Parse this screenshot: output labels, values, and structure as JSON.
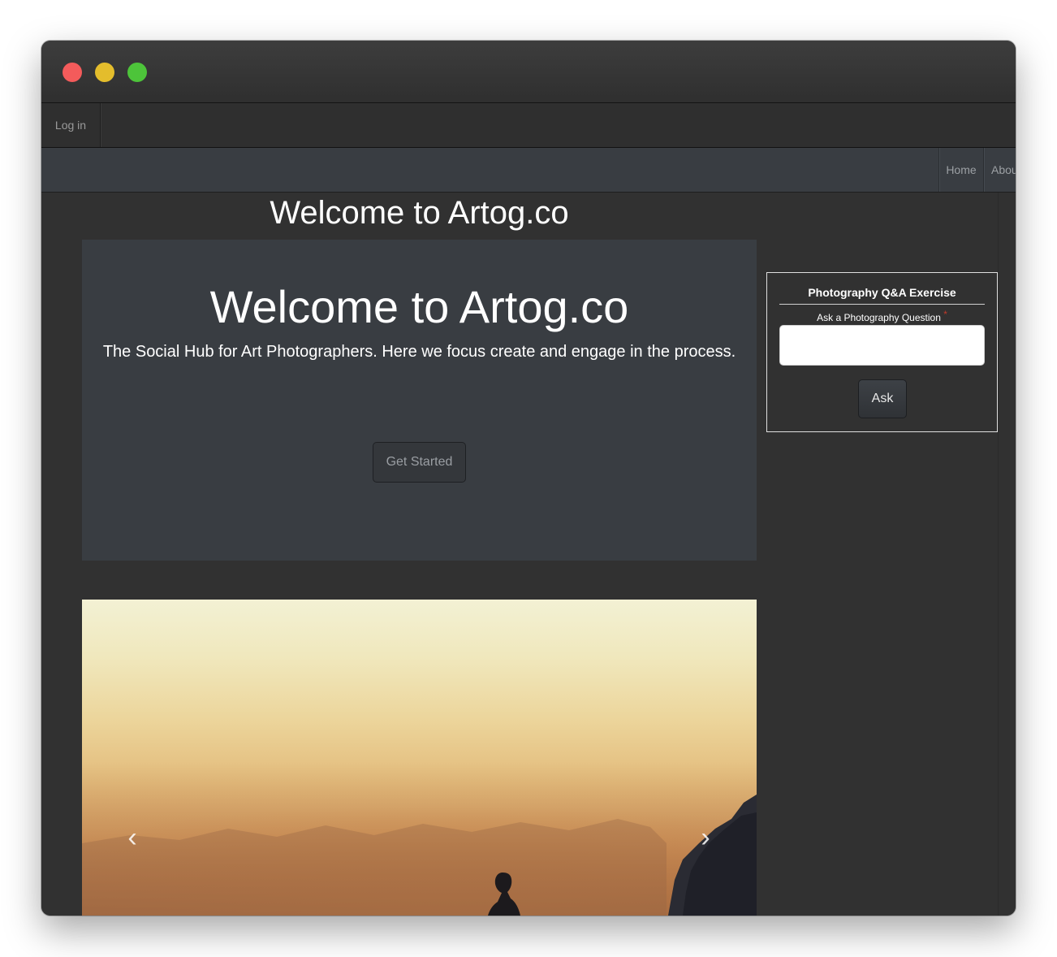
{
  "window": {
    "controls": [
      "close-dot",
      "minimize-dot",
      "maximize-dot"
    ]
  },
  "topbar": {
    "login_label": "Log in"
  },
  "navbar": {
    "items": [
      {
        "label": "Home"
      },
      {
        "label": "About"
      }
    ]
  },
  "main": {
    "page_heading": "Welcome to Artog.co",
    "jumbotron": {
      "title": "Welcome to Artog.co",
      "tagline": "The Social Hub for Art Photographers. Here we focus create and engage in the process.",
      "cta_label": "Get Started"
    },
    "carousel": {
      "prev_icon": "chevron-left-icon",
      "next_icon": "chevron-right-icon"
    }
  },
  "qa": {
    "title": "Photography Q&A Exercise",
    "question_label": "Ask a Photography Question",
    "required_marker": "*",
    "input_value": "",
    "submit_label": "Ask"
  },
  "colors": {
    "background": "#313131",
    "jumbotron": "#393d42",
    "navbar": "#393d42",
    "required": "#c0392b"
  }
}
